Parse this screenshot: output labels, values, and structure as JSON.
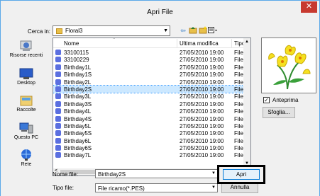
{
  "window": {
    "title": "Apri File",
    "close_label": "✕"
  },
  "lookin": {
    "label": "Cerca in:",
    "value": "Floral3"
  },
  "places": [
    {
      "label": "Risorse recenti"
    },
    {
      "label": "Desktop"
    },
    {
      "label": "Raccolte"
    },
    {
      "label": "Questo PC"
    },
    {
      "label": "Rete"
    }
  ],
  "columns": {
    "name": "Nome",
    "modified": "Ultima modifica",
    "type": "Tipo"
  },
  "files": [
    {
      "name": "33100115",
      "modified": "27/05/2010 19:00",
      "type": "File Ric"
    },
    {
      "name": "33100229",
      "modified": "27/05/2010 19:00",
      "type": "File Ric"
    },
    {
      "name": "Birthday1L",
      "modified": "27/05/2010 19:00",
      "type": "File Ric"
    },
    {
      "name": "Birthday1S",
      "modified": "27/05/2010 19:00",
      "type": "File Ric"
    },
    {
      "name": "Birthday2L",
      "modified": "27/05/2010 19:00",
      "type": "File Ric"
    },
    {
      "name": "Birthday2S",
      "modified": "27/05/2010 19:00",
      "type": "File Ric"
    },
    {
      "name": "Birthday3L",
      "modified": "27/05/2010 19:00",
      "type": "File Ric"
    },
    {
      "name": "Birthday3S",
      "modified": "27/05/2010 19:00",
      "type": "File Ric"
    },
    {
      "name": "Birthday4L",
      "modified": "27/05/2010 19:00",
      "type": "File Ric"
    },
    {
      "name": "Birthday4S",
      "modified": "27/05/2010 19:00",
      "type": "File Ric"
    },
    {
      "name": "Birthday5L",
      "modified": "27/05/2010 19:00",
      "type": "File Ric"
    },
    {
      "name": "Birthday5S",
      "modified": "27/05/2010 19:00",
      "type": "File Ric"
    },
    {
      "name": "Birthday6L",
      "modified": "27/05/2010 19:00",
      "type": "File Ric"
    },
    {
      "name": "Birthday6S",
      "modified": "27/05/2010 19:00",
      "type": "File Ric"
    },
    {
      "name": "Birthday7L",
      "modified": "27/05/2010 19:00",
      "type": "File Ric"
    }
  ],
  "selected_index": 5,
  "preview": {
    "checkbox_label": "Anteprima",
    "checked": true,
    "browse_label": "Sfoglia..."
  },
  "filename": {
    "label": "Nome file:",
    "value": "Birthday2S"
  },
  "filetype": {
    "label": "Tipo file:",
    "value": "File ricamo(*.PES)"
  },
  "buttons": {
    "open": "Apri",
    "cancel": "Annulla"
  },
  "colors": {
    "title_border": "#5aa8e8",
    "close_bg": "#c7392f",
    "selection": "#cce8ff",
    "file_icon": "#5b6fe0"
  }
}
